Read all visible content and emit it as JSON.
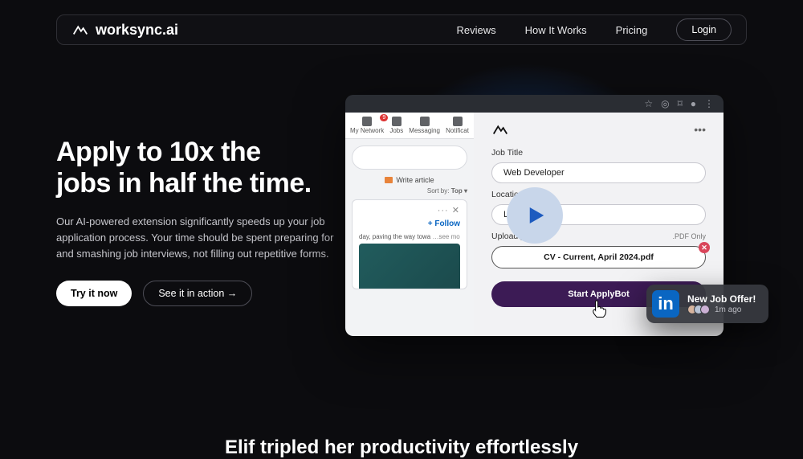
{
  "nav": {
    "brand": "worksync.ai",
    "links": [
      "Reviews",
      "How It Works",
      "Pricing"
    ],
    "login": "Login"
  },
  "hero": {
    "headline_l1": "Apply to 10x the",
    "headline_l2": "jobs in half the time.",
    "sub": "Our AI-powered extension significantly speeds up your job application process. Your time should be spent preparing for and smashing job interviews, not filling out repetitive forms.",
    "cta_primary": "Try it now",
    "cta_secondary": "See it in action →"
  },
  "feed": {
    "items": [
      "My Network",
      "Jobs",
      "Messaging",
      "Notificat"
    ],
    "write": "Write article",
    "sort": "Sort by:",
    "sort_val": "Top ▾",
    "follow": "+ Follow",
    "post_text": "day, paving the way towa",
    "see_more": "…see more",
    "dots": "···    ✕"
  },
  "ext": {
    "job_label": "Job Title",
    "job_val": "Web Developer",
    "loc_label": "Location",
    "loc_val": "Lon",
    "upload_label": "Upload yo",
    "pdf_hint": ".PDF Only",
    "cv": "CV - Current, April 2024.pdf",
    "start": "Start ApplyBot"
  },
  "notif": {
    "title": "New Job Offer!",
    "ago": "1m ago"
  },
  "teaser": "Elif tripled her productivity effortlessly"
}
